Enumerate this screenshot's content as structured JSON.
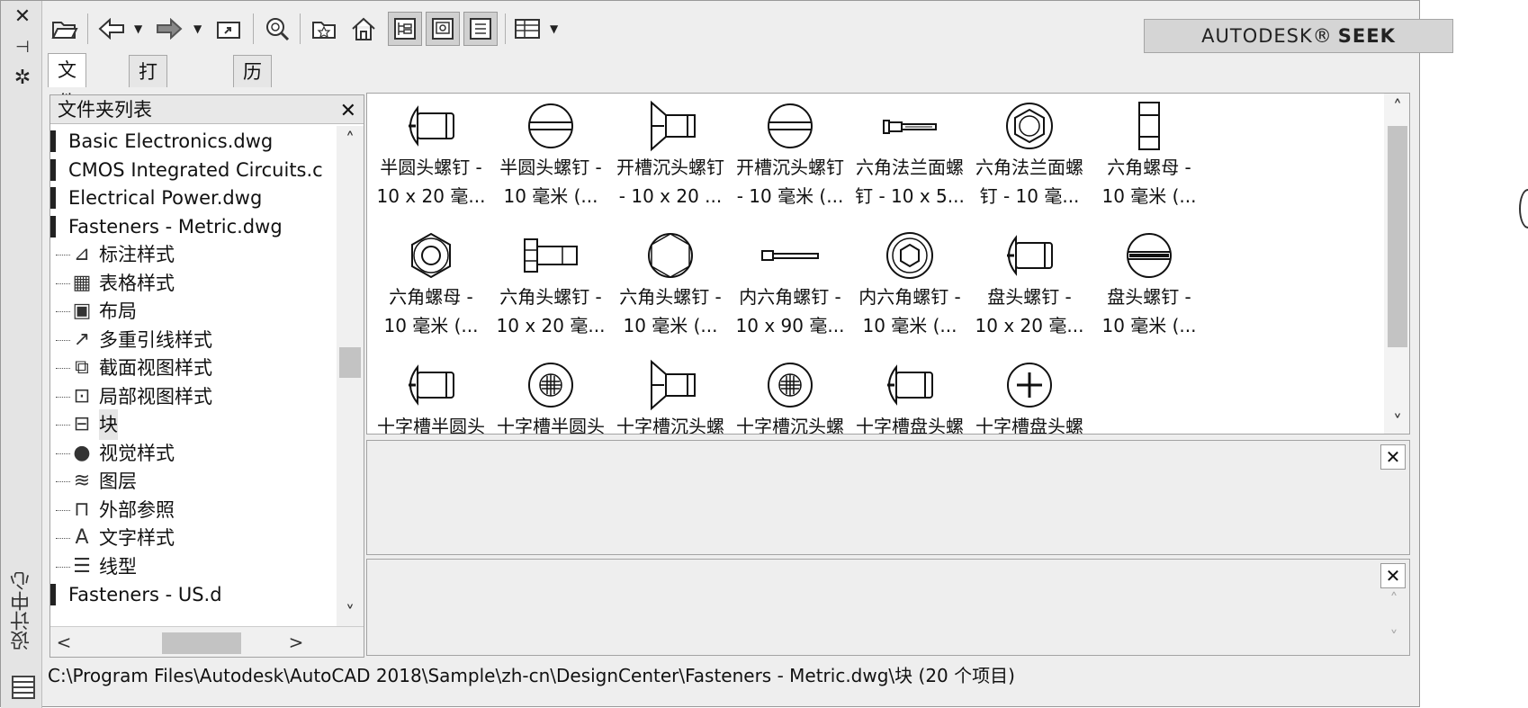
{
  "sidebar": {
    "close": "✕",
    "pin": "⊣",
    "settings": "✲",
    "title": "设计中心"
  },
  "toolbar": {
    "icons": [
      "open-folder-icon",
      "back-icon",
      "forward-icon",
      "up-folder-icon",
      "search-icon",
      "favorites-icon",
      "home-icon",
      "tree-view-icon",
      "preview-icon",
      "description-icon",
      "views-icon"
    ],
    "brand": "AUTODESK®",
    "product": "SEEK"
  },
  "tabs": [
    "文件夹",
    "打开的图形",
    "历史记录"
  ],
  "folder_panel": {
    "header": "文件夹列表",
    "files": [
      "Basic Electronics.dwg",
      "CMOS Integrated Circuits.c",
      "Electrical Power.dwg",
      "Fasteners - Metric.dwg"
    ],
    "children": [
      {
        "icon": "dimension-style-icon",
        "glyph": "⊿",
        "label": "标注样式"
      },
      {
        "icon": "table-style-icon",
        "glyph": "▦",
        "label": "表格样式"
      },
      {
        "icon": "layout-icon",
        "glyph": "▣",
        "label": "布局"
      },
      {
        "icon": "multileader-style-icon",
        "glyph": "↗",
        "label": "多重引线样式"
      },
      {
        "icon": "section-view-style-icon",
        "glyph": "⧉",
        "label": "截面视图样式"
      },
      {
        "icon": "detail-view-style-icon",
        "glyph": "⊡",
        "label": "局部视图样式"
      },
      {
        "icon": "block-icon",
        "glyph": "⊟",
        "label": "块"
      },
      {
        "icon": "visual-style-icon",
        "glyph": "●",
        "label": "视觉样式"
      },
      {
        "icon": "layer-icon",
        "glyph": "≋",
        "label": "图层"
      },
      {
        "icon": "xref-icon",
        "glyph": "⊓",
        "label": "外部参照"
      },
      {
        "icon": "text-style-icon",
        "glyph": "A",
        "label": "文字样式"
      },
      {
        "icon": "linetype-icon",
        "glyph": "☰",
        "label": "线型"
      }
    ],
    "partial": "Fasteners - US.d"
  },
  "items": [
    {
      "l1": "半圆头螺钉 -",
      "l2": "10 x 20 毫...",
      "icon": "pan-slot-side-icon"
    },
    {
      "l1": "半圆头螺钉 -",
      "l2": "10 毫米 (...",
      "icon": "slot-top-icon"
    },
    {
      "l1": "开槽沉头螺钉",
      "l2": "- 10 x 20 ...",
      "icon": "countersunk-side-icon"
    },
    {
      "l1": "开槽沉头螺钉",
      "l2": "- 10 毫米 (...",
      "icon": "slot-top-icon"
    },
    {
      "l1": "六角法兰面螺",
      "l2": "钉 - 10 x 5...",
      "icon": "flange-bolt-side-icon"
    },
    {
      "l1": "六角法兰面螺",
      "l2": "钉 - 10 毫...",
      "icon": "hex-flange-top-icon"
    },
    {
      "l1": "六角螺母 -",
      "l2": "10 毫米 (...",
      "icon": "hex-nut-side-icon"
    },
    {
      "l1": "六角螺母 -",
      "l2": "10 毫米 (...",
      "icon": "hex-nut-top-icon"
    },
    {
      "l1": "六角头螺钉 -",
      "l2": "10 x 20 毫...",
      "icon": "hex-bolt-side-icon"
    },
    {
      "l1": "六角头螺钉 -",
      "l2": "10 毫米 (...",
      "icon": "hex-top-icon"
    },
    {
      "l1": "内六角螺钉 -",
      "l2": "10 x 90 毫...",
      "icon": "socket-long-side-icon"
    },
    {
      "l1": "内六角螺钉 -",
      "l2": "10 毫米 (...",
      "icon": "socket-top-icon"
    },
    {
      "l1": "盘头螺钉 -",
      "l2": "10 x 20 毫...",
      "icon": "pan-side-icon"
    },
    {
      "l1": "盘头螺钉 -",
      "l2": "10 毫米 (...",
      "icon": "pan-slot-top-icon"
    },
    {
      "l1": "十字槽半圆头",
      "l2": "",
      "icon": "phillips-pan-side-icon"
    },
    {
      "l1": "十字槽半圆头",
      "l2": "",
      "icon": "phillips-top-icon"
    },
    {
      "l1": "十字槽沉头螺",
      "l2": "",
      "icon": "phillips-countersunk-side-icon"
    },
    {
      "l1": "十字槽沉头螺",
      "l2": "",
      "icon": "phillips-top-icon"
    },
    {
      "l1": "十字槽盘头螺",
      "l2": "",
      "icon": "phillips-pan-head-side-icon"
    },
    {
      "l1": "十字槽盘头螺",
      "l2": "",
      "icon": "phillips-top-plus-icon"
    }
  ],
  "status": "C:\\Program Files\\Autodesk\\AutoCAD 2018\\Sample\\zh-cn\\DesignCenter\\Fasteners - Metric.dwg\\块 (20 个项目)"
}
